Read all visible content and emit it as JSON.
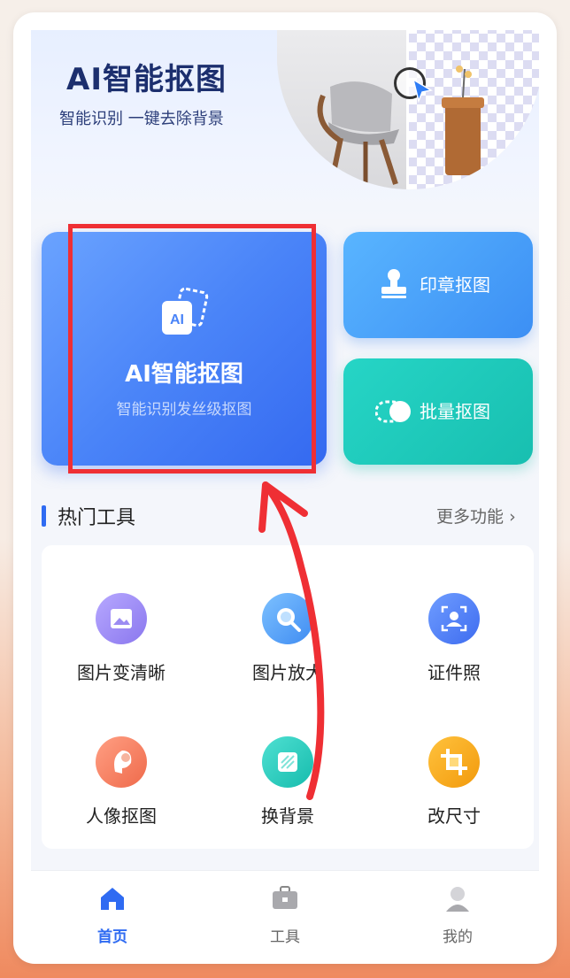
{
  "banner": {
    "title": "AI智能抠图",
    "subtitle": "智能识别  一键去除背景"
  },
  "main_card": {
    "icon_text": "AI",
    "title": "AI智能抠图",
    "subtitle": "智能识别发丝级抠图"
  },
  "side_cards": [
    {
      "label": "印章抠图",
      "icon": "stamp-icon"
    },
    {
      "label": "批量抠图",
      "icon": "toggle-icon"
    }
  ],
  "hot_tools": {
    "title": "热门工具",
    "more": "更多功能",
    "items": [
      {
        "label": "图片变清晰",
        "icon": "image-icon",
        "color": "#9c8cf2"
      },
      {
        "label": "图片放大",
        "icon": "magnifier-icon",
        "color": "#4c9df5"
      },
      {
        "label": "证件照",
        "icon": "id-photo-icon",
        "color": "#4a7cf2"
      },
      {
        "label": "人像抠图",
        "icon": "portrait-icon",
        "color": "#f27a5c"
      },
      {
        "label": "换背景",
        "icon": "background-swap-icon",
        "color": "#22c7b7"
      },
      {
        "label": "改尺寸",
        "icon": "crop-icon",
        "color": "#f5a416"
      }
    ]
  },
  "tabbar": {
    "items": [
      {
        "label": "首页",
        "icon": "home-icon",
        "active": true
      },
      {
        "label": "工具",
        "icon": "toolbox-icon",
        "active": false
      },
      {
        "label": "我的",
        "icon": "user-icon",
        "active": false
      }
    ]
  },
  "colors": {
    "accent": "#2f6bf2",
    "annotation": "#ef2f34"
  }
}
